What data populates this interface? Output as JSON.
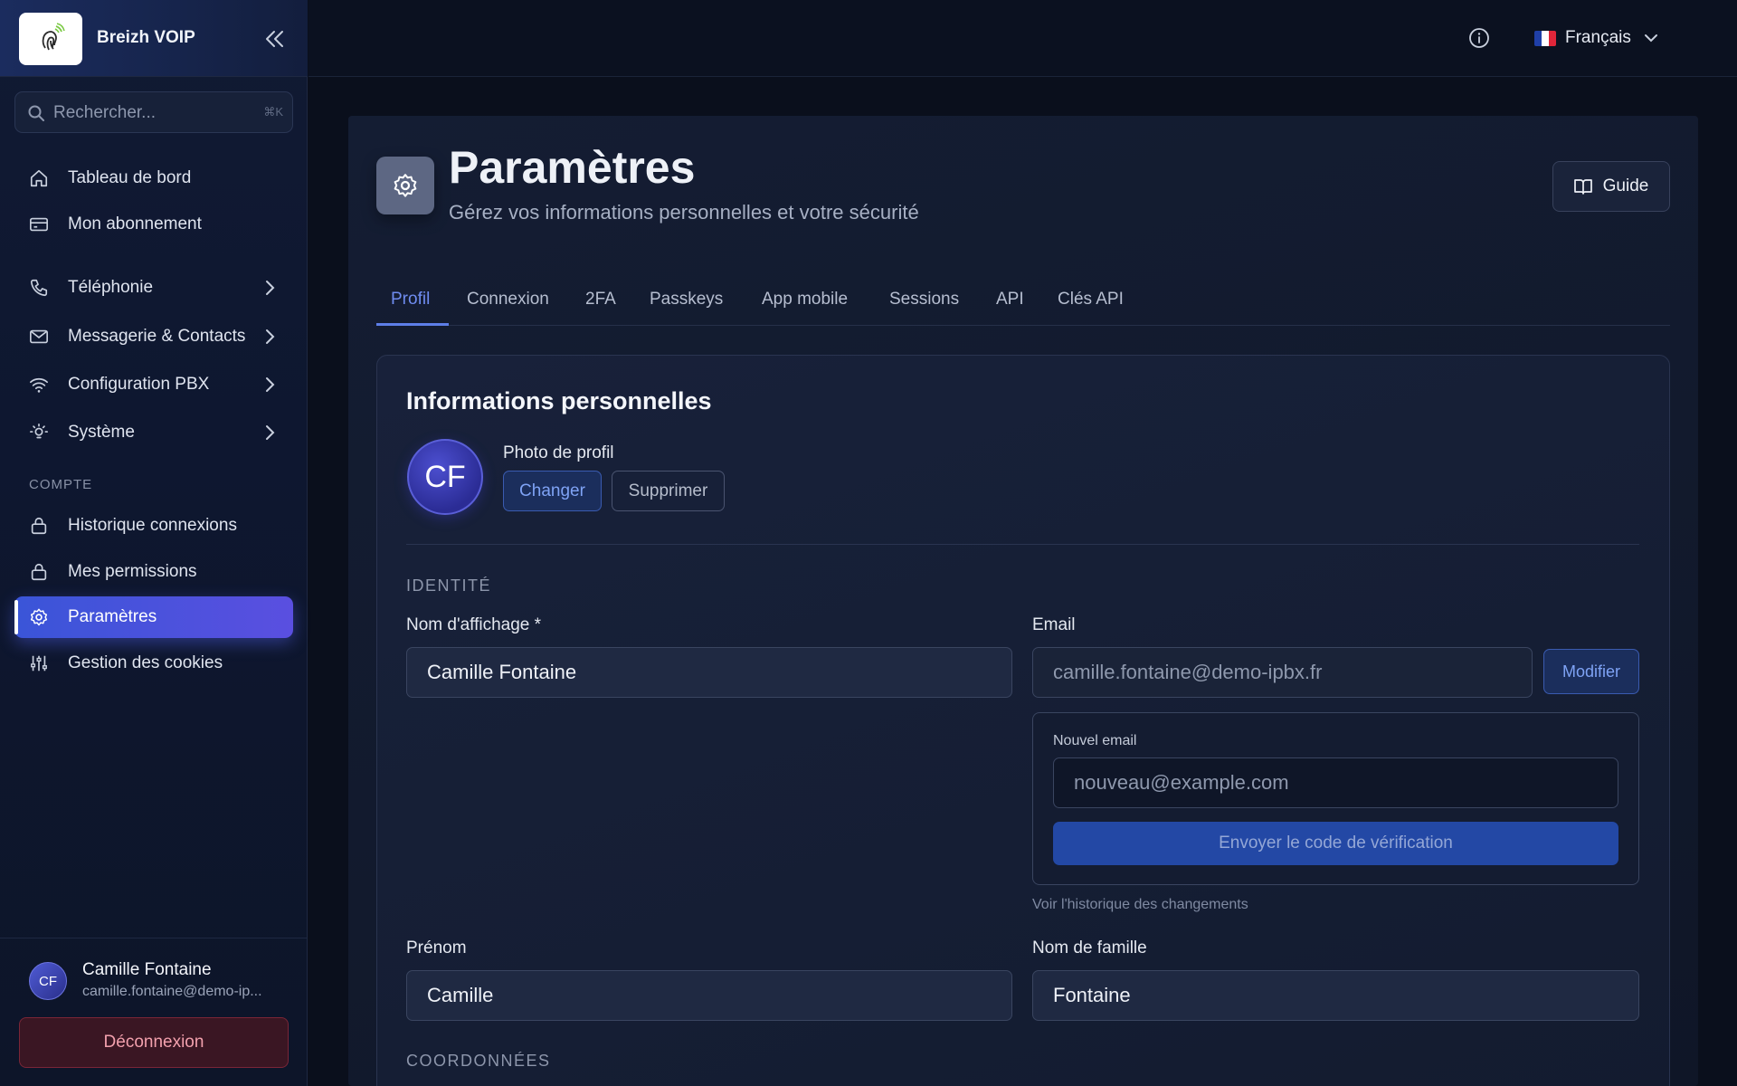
{
  "sidebar": {
    "brand_name": "Breizh VOIP",
    "search": {
      "placeholder": "Rechercher...",
      "shortcut": "⌘K"
    },
    "items": [
      {
        "label": "Tableau de bord",
        "icon": "home-icon"
      },
      {
        "label": "Mon abonnement",
        "icon": "card-icon"
      },
      {
        "label": "Téléphonie",
        "icon": "phone-icon",
        "has_children": true
      },
      {
        "label": "Messagerie & Contacts",
        "icon": "mail-icon",
        "has_children": true
      },
      {
        "label": "Configuration PBX",
        "icon": "wifi-icon",
        "has_children": true
      },
      {
        "label": "Système",
        "icon": "bulb-icon",
        "has_children": true
      }
    ],
    "section_label": "COMPTE",
    "account_items": [
      {
        "label": "Historique connexions",
        "icon": "lock-icon"
      },
      {
        "label": "Mes permissions",
        "icon": "lock-icon"
      },
      {
        "label": "Paramètres",
        "icon": "gear-icon",
        "active": true
      },
      {
        "label": "Gestion des cookies",
        "icon": "sliders-icon"
      }
    ],
    "user": {
      "initials": "CF",
      "name": "Camille Fontaine",
      "email": "camille.fontaine@demo-ip..."
    },
    "logout_label": "Déconnexion"
  },
  "topbar": {
    "language": "Français"
  },
  "page": {
    "title": "Paramètres",
    "subtitle": "Gérez vos informations personnelles et votre sécurité",
    "guide_label": "Guide"
  },
  "tabs": [
    {
      "label": "Profil",
      "active": true
    },
    {
      "label": "Connexion"
    },
    {
      "label": "2FA"
    },
    {
      "label": "Passkeys"
    },
    {
      "label": "App mobile"
    },
    {
      "label": "Sessions"
    },
    {
      "label": "API"
    },
    {
      "label": "Clés API"
    }
  ],
  "profile": {
    "card_title": "Informations personnelles",
    "avatar_initials": "CF",
    "photo_label": "Photo de profil",
    "change_label": "Changer",
    "delete_label": "Supprimer",
    "identity_section": "IDENTITÉ",
    "display_name_label": "Nom d'affichage *",
    "display_name_value": "Camille Fontaine",
    "email_label": "Email",
    "email_value": "camille.fontaine@demo-ipbx.fr",
    "modify_label": "Modifier",
    "new_email_label": "Nouvel email",
    "new_email_placeholder": "nouveau@example.com",
    "send_code_label": "Envoyer le code de vérification",
    "history_link": "Voir l'historique des changements",
    "first_name_label": "Prénom",
    "first_name_value": "Camille",
    "last_name_label": "Nom de famille",
    "last_name_value": "Fontaine",
    "contact_section": "COORDONNÉES"
  },
  "colors": {
    "accent": "#5a6ff0",
    "active_nav": "#4f55e0",
    "danger": "#f2a0ad"
  }
}
